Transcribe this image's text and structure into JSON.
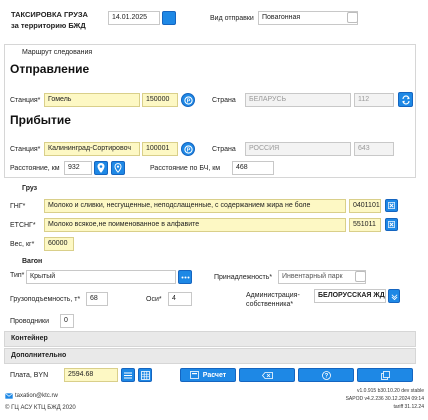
{
  "header": {
    "title_line1": "ТАКСИРОВКА ГРУЗА",
    "title_line2": "за территорию БЖД",
    "date": "14.01.2025",
    "dispatch_label": "Вид отправки",
    "dispatch_value": "Повагонная"
  },
  "route": {
    "title": "Маршрут следования",
    "departure_title": "Отправление",
    "departure": {
      "station_label": "Станция*",
      "station_name": "Гомель",
      "station_code": "150000",
      "country_label": "Страна",
      "country_name": "БЕЛАРУСЬ",
      "country_code": "112"
    },
    "arrival_title": "Прибытие",
    "arrival": {
      "station_label": "Станция*",
      "station_name": "Калининград-Сортировоч",
      "station_code": "100001",
      "country_label": "Страна",
      "country_name": "РОССИЯ",
      "country_code": "643"
    },
    "distance_label": "Расстояние, км",
    "distance_value": "932",
    "bch_distance_label": "Расстояние по БЧ, км",
    "bch_distance_value": "468"
  },
  "cargo": {
    "title": "Груз",
    "gng_label": "ГНГ*",
    "gng_name": "Молоко и сливки, несгущенные, неподслащенные, с содержанием жира не боле",
    "gng_code": "04011010",
    "etsng_label": "ЕТСНГ*",
    "etsng_name": "Молоко всякое,не поименованное в алфавите",
    "etsng_code": "551011",
    "weight_label": "Вес, кг*",
    "weight_value": "60000"
  },
  "wagon": {
    "title": "Вагон",
    "type_label": "Тип*",
    "type_value": "Крытый",
    "ownership_label": "Принадлежность*",
    "ownership_value": "Инвентарный парк",
    "capacity_label": "Грузоподъемность, т*",
    "capacity_value": "68",
    "axles_label": "Оси*",
    "axles_value": "4",
    "admin_label_line1": "Администрация-",
    "admin_label_line2": "собственника*",
    "admin_value": "БЕЛОРУССКАЯ ЖД",
    "conductors_label": "Проводники",
    "conductors_value": "0"
  },
  "sections": {
    "container": "Контейнер",
    "additional": "Дополнительно"
  },
  "payment": {
    "label": "Плата, BYN",
    "value": "2594.68",
    "calc_button": "Расчет"
  },
  "footer": {
    "email": "taxation@ktc.rw",
    "copyright": "© ГЦ АСУ КТЦ БЖД 2020",
    "version1": "v1.0.915 b30.10.20 dev stable",
    "version2": "SAPOD v4.2.236 30.12.2024 09:14",
    "version3": "tariff 31.12.24"
  },
  "colors": {
    "accent": "#1e88e5",
    "required_field": "#fdf8c4",
    "disabled_field": "#f3f3f3"
  }
}
